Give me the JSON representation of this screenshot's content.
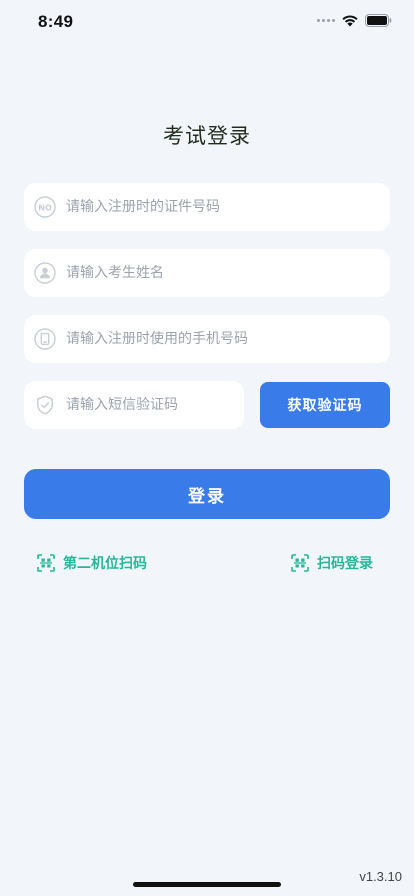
{
  "status_bar": {
    "time": "8:49"
  },
  "page": {
    "title": "考试登录"
  },
  "form": {
    "id_number": {
      "placeholder": "请输入注册时的证件号码",
      "value": ""
    },
    "name": {
      "placeholder": "请输入考生姓名",
      "value": ""
    },
    "phone": {
      "placeholder": "请输入注册时使用的手机号码",
      "value": ""
    },
    "sms_code": {
      "placeholder": "请输入短信验证码",
      "value": ""
    },
    "get_code_label": "获取验证码",
    "login_label": "登录"
  },
  "links": {
    "second_camera_scan": "第二机位扫码",
    "scan_login": "扫码登录"
  },
  "footer": {
    "version": "v1.3.10"
  },
  "colors": {
    "primary": "#3a7bea",
    "accent_green": "#23b89a",
    "background": "#f2f6fb",
    "field_background": "#ffffff",
    "placeholder": "#9ba3ad"
  },
  "icons": {
    "id_field": "id-card-no-icon",
    "name_field": "person-icon",
    "phone_field": "mobile-phone-icon",
    "code_field": "shield-check-icon",
    "scan": "qr-scan-icon"
  }
}
